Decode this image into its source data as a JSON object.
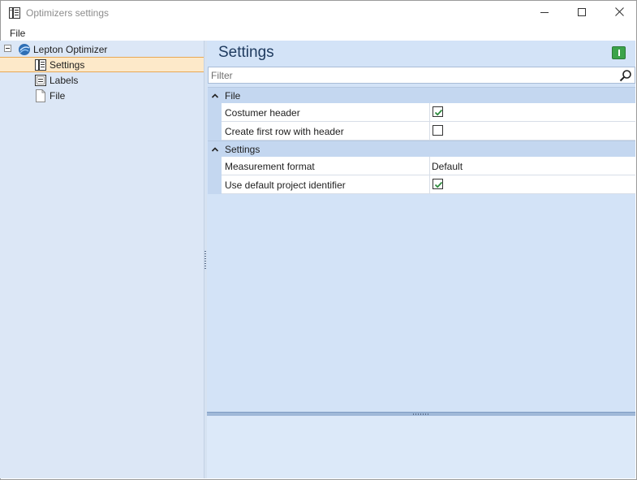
{
  "window": {
    "title": "Optimizers settings",
    "icon": "settings-document-icon"
  },
  "menu": {
    "items": [
      {
        "label": "File"
      }
    ]
  },
  "tree": {
    "root": {
      "label": "Lepton Optimizer",
      "icon": "globe-icon",
      "expanded": true
    },
    "children": [
      {
        "label": "Settings",
        "icon": "settings-document-icon",
        "selected": true
      },
      {
        "label": "Labels",
        "icon": "labels-icon",
        "selected": false
      },
      {
        "label": "File",
        "icon": "file-icon",
        "selected": false
      }
    ]
  },
  "page": {
    "title": "Settings",
    "info_button_color": "#3ba34a"
  },
  "filter": {
    "placeholder": "Filter",
    "value": ""
  },
  "categories": [
    {
      "label": "File",
      "expanded": true,
      "rows": [
        {
          "name": "Costumer header",
          "type": "checkbox",
          "checked": true
        },
        {
          "name": "Create first row with header",
          "type": "checkbox",
          "checked": false
        }
      ]
    },
    {
      "label": "Settings",
      "expanded": true,
      "rows": [
        {
          "name": "Measurement format",
          "type": "text",
          "value": "Default"
        },
        {
          "name": "Use default project identifier",
          "type": "checkbox",
          "checked": true
        }
      ]
    }
  ],
  "colors": {
    "selection_bg": "#fde9c9",
    "selection_border": "#e8a854",
    "panel_bg": "#d3e3f7",
    "category_bg": "#c4d7f0",
    "check_green": "#2e8b3d"
  }
}
